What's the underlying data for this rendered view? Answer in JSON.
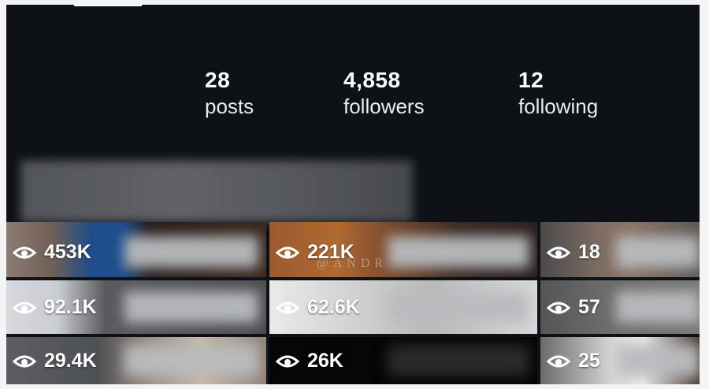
{
  "profile": {
    "stats": [
      {
        "value": "28",
        "label": "posts"
      },
      {
        "value": "4,858",
        "label": "followers"
      },
      {
        "value": "12",
        "label": "following"
      }
    ]
  },
  "grid": {
    "tiles": [
      {
        "views": "453K"
      },
      {
        "views": "221K"
      },
      {
        "views": "18"
      },
      {
        "views": "92.1K"
      },
      {
        "views": "62.6K"
      },
      {
        "views": "57"
      },
      {
        "views": "29.4K"
      },
      {
        "views": "26K"
      },
      {
        "views": "25"
      }
    ],
    "view_icon": "eye-icon"
  },
  "colors": {
    "header_bg": "#0e1216",
    "text": "#ffffff"
  }
}
